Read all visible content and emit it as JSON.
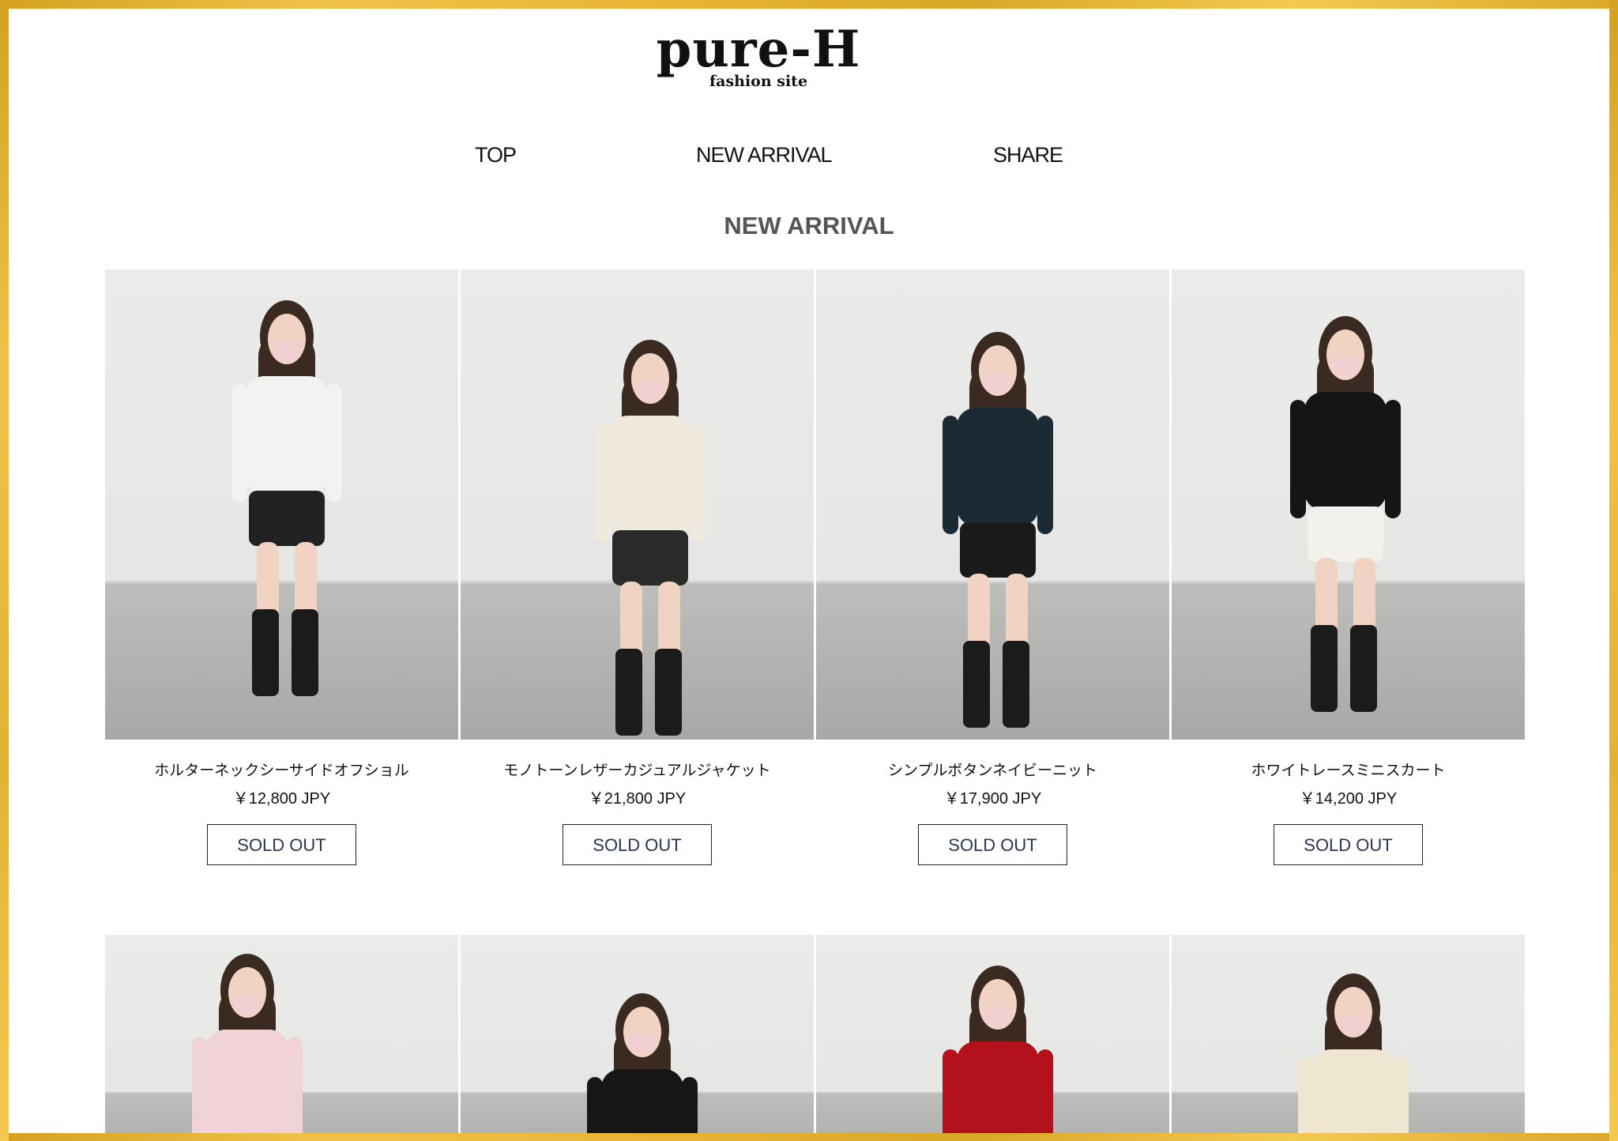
{
  "brand": {
    "name": "pure-H",
    "tagline": "fashion site"
  },
  "nav": {
    "items": [
      "TOP",
      "NEW ARRIVAL",
      "SHARE"
    ]
  },
  "section": {
    "title": "NEW ARRIVAL"
  },
  "products": [
    {
      "name": "ホルターネックシーサイドオフショル",
      "price": "￥12,800 JPY",
      "button": "SOLD OUT",
      "top_color": "#f2f2f0",
      "bottom_color": "#222222"
    },
    {
      "name": "モノトーンレザーカジュアルジャケット",
      "price": "￥21,800 JPY",
      "button": "SOLD OUT",
      "top_color": "#efe9de",
      "bottom_color": "#2a2a2a"
    },
    {
      "name": "シンプルボタンネイビーニット",
      "price": "￥17,900 JPY",
      "button": "SOLD OUT",
      "top_color": "#1c2a33",
      "bottom_color": "#1a1a1a"
    },
    {
      "name": "ホワイトレースミニスカート",
      "price": "￥14,200 JPY",
      "button": "SOLD OUT",
      "top_color": "#151515",
      "bottom_color": "#f3f1ec"
    }
  ],
  "products_row2": [
    {
      "top_color": "#f1d2d6"
    },
    {
      "top_color": "#161616"
    },
    {
      "top_color": "#b3121c"
    },
    {
      "top_color": "#efe6d2"
    }
  ],
  "colors": {
    "frame": "#e8b535",
    "text": "#111111",
    "section_title": "#555555"
  }
}
